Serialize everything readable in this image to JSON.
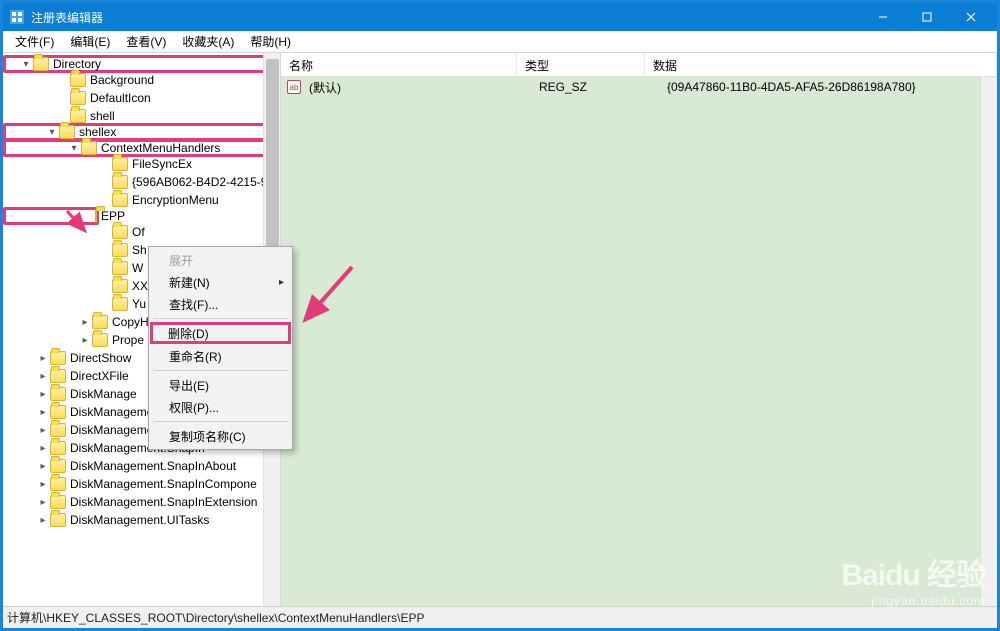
{
  "window": {
    "title": "注册表编辑器"
  },
  "menubar": {
    "file": "文件(F)",
    "edit": "编辑(E)",
    "view": "查看(V)",
    "favorites": "收藏夹(A)",
    "help": "帮助(H)"
  },
  "tree": {
    "directory": "Directory",
    "background": "Background",
    "defaulticon": "DefaultIcon",
    "shell": "shell",
    "shellex": "shellex",
    "contextmenuhandlers": "ContextMenuHandlers",
    "filesyncex": "FileSyncEx",
    "guid_node": "{596AB062-B4D2-4215-9",
    "encryptionmenu": "EncryptionMenu",
    "epp": "EPP",
    "of": "Of",
    "sh": "Sh",
    "wo": "W",
    "xx": "XX",
    "yu": "Yu",
    "copyh": "CopyH",
    "prope": "Prope",
    "directshow": "DirectShow",
    "directxfile": "DirectXFile",
    "diskmanagement": "DiskManage",
    "diskmanagement_control": "DiskManagement.Control",
    "diskmanagement_dataobject": "DiskManagement.DataObject",
    "diskmanagement_snapin": "DiskManagement.SnapIn",
    "diskmanagement_snapinabout": "DiskManagement.SnapInAbout",
    "diskmanagement_snapincomponent": "DiskManagement.SnapInCompone",
    "diskmanagement_snapinextension": "DiskManagement.SnapInExtension",
    "diskmanagement_uitasks": "DiskManagement.UITasks"
  },
  "list": {
    "columns": {
      "name": "名称",
      "type": "类型",
      "data": "数据"
    },
    "rows": [
      {
        "name": "(默认)",
        "type": "REG_SZ",
        "data": "{09A47860-11B0-4DA5-AFA5-26D86198A780}"
      }
    ]
  },
  "context_menu": {
    "expand": "展开",
    "new": "新建(N)",
    "find": "查找(F)...",
    "delete": "删除(D)",
    "rename": "重命名(R)",
    "export": "导出(E)",
    "permissions": "权限(P)...",
    "copykeyname": "复制项名称(C)"
  },
  "statusbar": {
    "path": "计算机\\HKEY_CLASSES_ROOT\\Directory\\shellex\\ContextMenuHandlers\\EPP"
  },
  "watermark": {
    "logo": "Baidu 经验",
    "url": "jingyan.baidu.com"
  }
}
